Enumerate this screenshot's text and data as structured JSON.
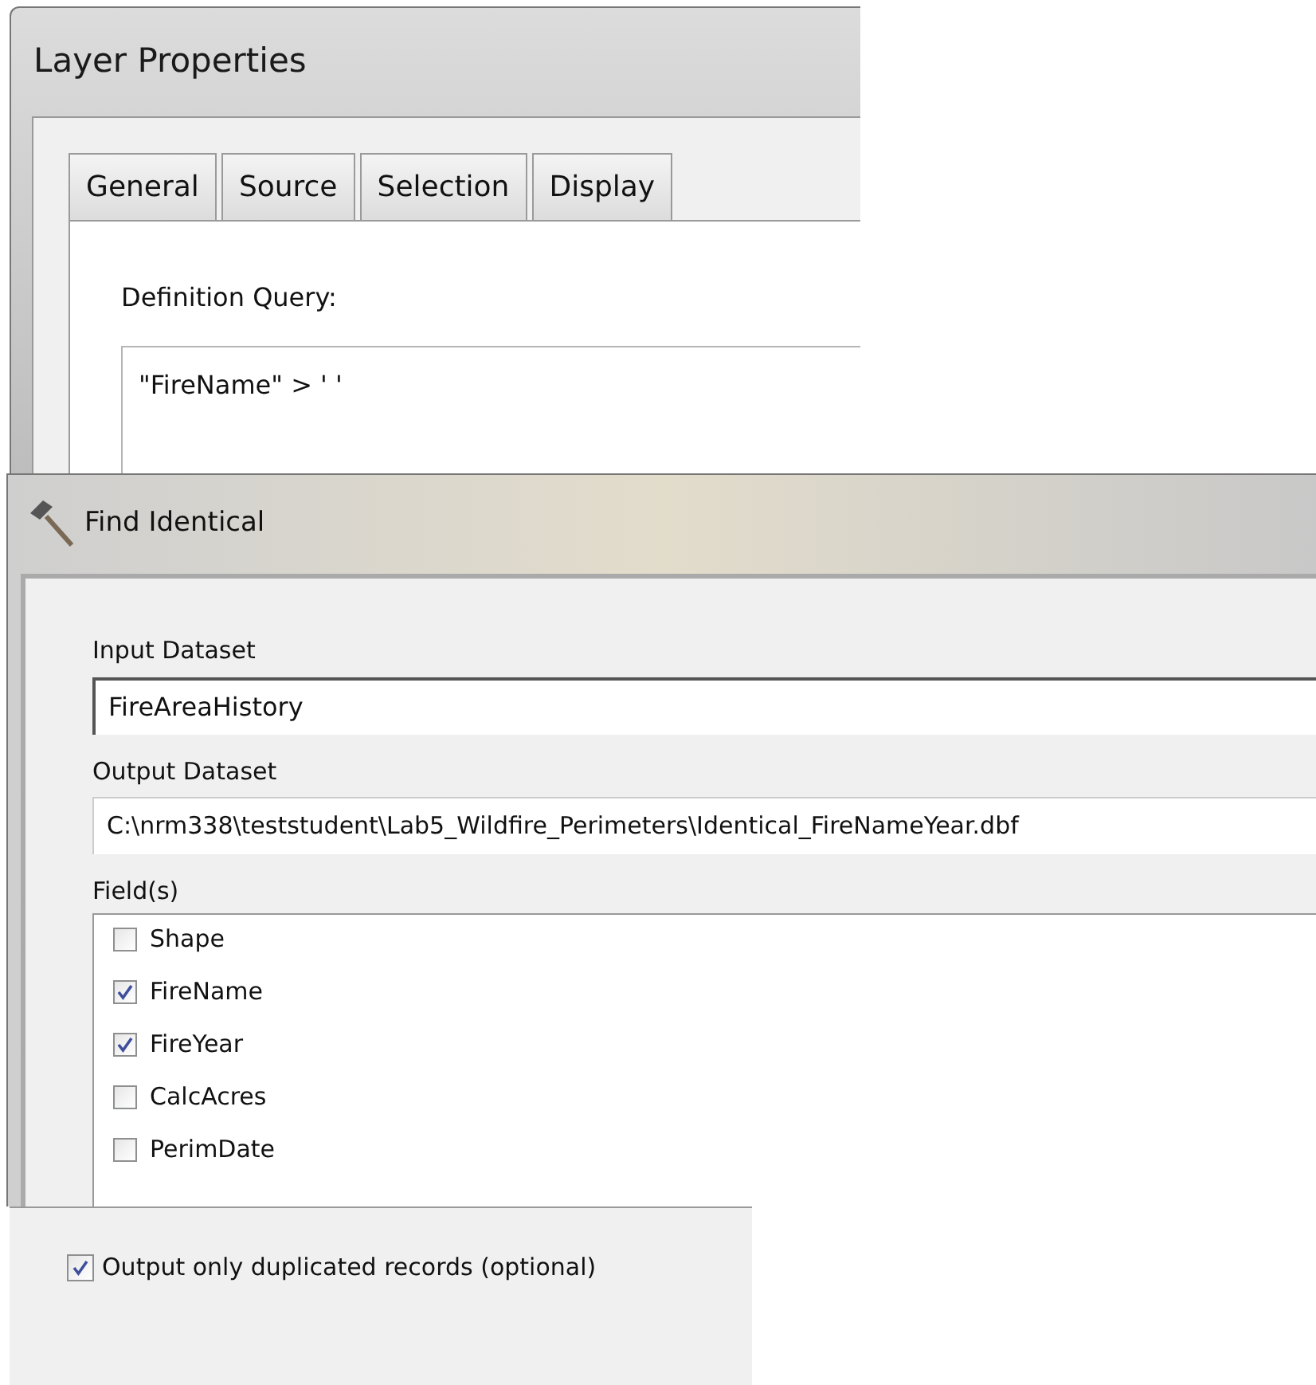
{
  "layer_properties": {
    "title": "Layer Properties",
    "tabs": [
      {
        "label": "General",
        "selected": false
      },
      {
        "label": "Source",
        "selected": false
      },
      {
        "label": "Selection",
        "selected": false
      },
      {
        "label": "Display",
        "selected": false
      }
    ],
    "definition_query": {
      "label": "Definition Query:",
      "value": "\"FireName\" > ' '"
    }
  },
  "find_identical": {
    "title": "Find Identical",
    "input_dataset": {
      "label": "Input Dataset",
      "value": "FireAreaHistory"
    },
    "output_dataset": {
      "label": "Output Dataset",
      "value": "C:\\nrm338\\teststudent\\Lab5_Wildfire_Perimeters\\Identical_FireNameYear.dbf"
    },
    "fields": {
      "label": "Field(s)",
      "items": [
        {
          "label": "Shape",
          "checked": false
        },
        {
          "label": "FireName",
          "checked": true
        },
        {
          "label": "FireYear",
          "checked": true
        },
        {
          "label": "CalcAcres",
          "checked": false
        },
        {
          "label": "PerimDate",
          "checked": false
        }
      ]
    }
  },
  "output_only_duplicates": {
    "label": "Output only duplicated records (optional)",
    "checked": true
  }
}
